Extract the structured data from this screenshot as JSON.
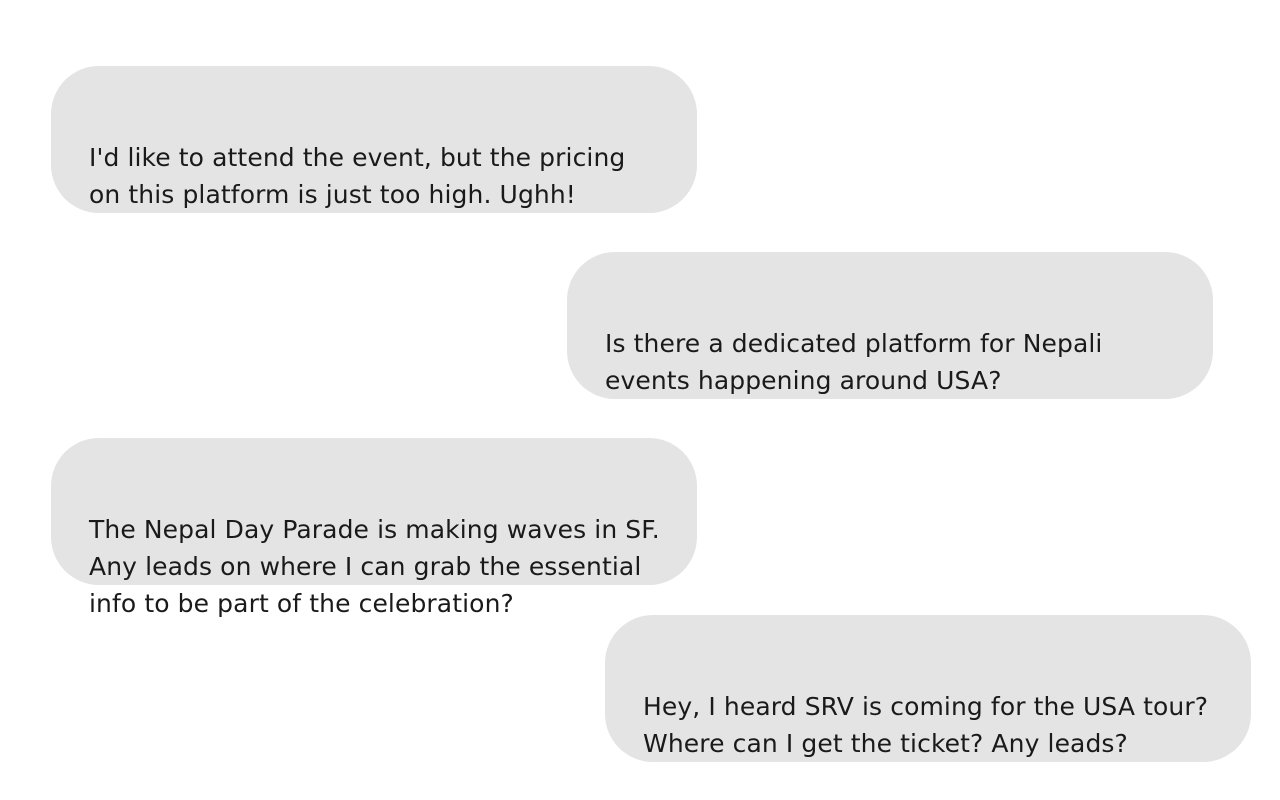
{
  "colors": {
    "background": "#ffffff",
    "bubble": "#e4e4e4",
    "text": "#1a1a1a"
  },
  "messages": [
    {
      "side": "left",
      "text": "I'd like to attend the event, but the pricing\non this platform is just too high. Ughh!"
    },
    {
      "side": "right",
      "text": "Is there a dedicated platform for Nepali\nevents happening around USA?"
    },
    {
      "side": "left",
      "text": "The Nepal Day Parade is making waves in SF.\nAny leads on where I can grab the essential\ninfo to be part of the celebration?"
    },
    {
      "side": "right",
      "text": "Hey, I heard SRV is coming for the USA tour?\nWhere can I get the ticket? Any leads?"
    }
  ]
}
